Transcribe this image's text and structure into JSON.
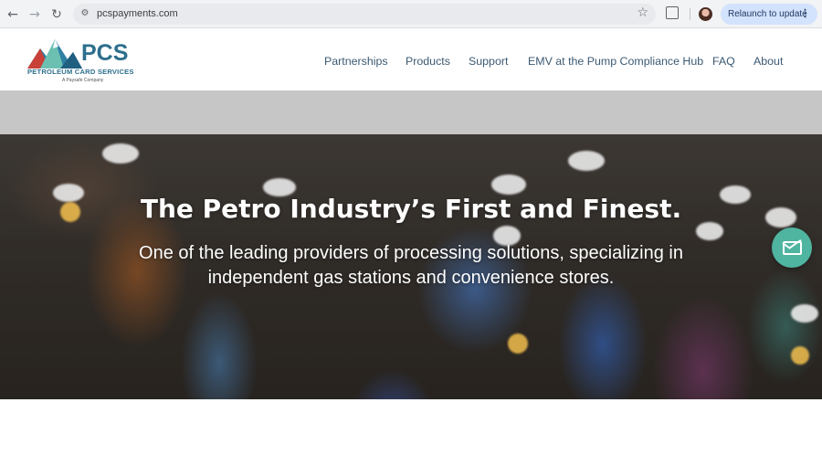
{
  "browser": {
    "url": "pcspayments.com",
    "relaunch_label": "Relaunch to update",
    "back_icon": "back-arrow-icon",
    "forward_icon": "forward-arrow-icon",
    "reload_icon": "reload-icon"
  },
  "header": {
    "logo": {
      "wordmark": "PCS",
      "subtitle": "PETROLEUM CARD SERVICES",
      "tagline": "A Paysafe Company"
    },
    "nav": [
      {
        "label": "Partnerships"
      },
      {
        "label": "Products"
      },
      {
        "label": "Support"
      },
      {
        "label": "EMV at the Pump Compliance Hub"
      },
      {
        "label": "FAQ"
      },
      {
        "label": "About"
      }
    ]
  },
  "hero": {
    "title": "The Petro Industry’s First and Finest.",
    "subtitle": "One of the leading providers of processing solutions, specializing in independent gas stations and convenience stores."
  },
  "contact": {
    "icon": "mail-icon"
  },
  "colors": {
    "brand_blue": "#2d6f8c",
    "nav_text": "#3c5a73",
    "fab_teal": "#4fb4a0",
    "gray_band": "#c6c6c6"
  }
}
